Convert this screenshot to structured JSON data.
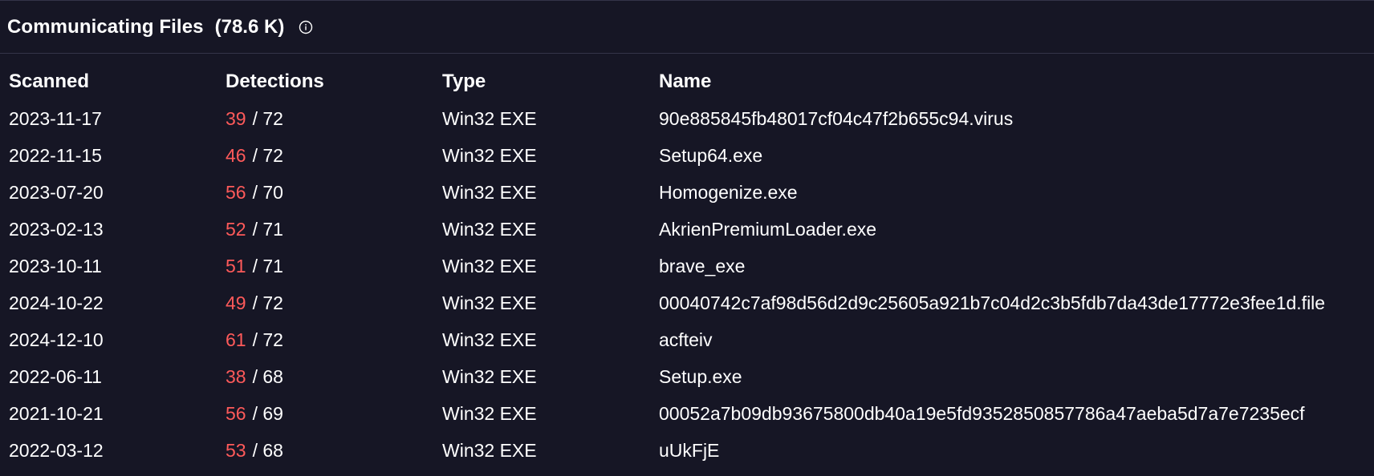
{
  "header": {
    "title": "Communicating Files",
    "count": "(78.6 K)"
  },
  "columns": {
    "scanned": "Scanned",
    "detections": "Detections",
    "type": "Type",
    "name": "Name"
  },
  "rows": [
    {
      "scanned": "2023-11-17",
      "positives": "39",
      "total": "/ 72",
      "type": "Win32 EXE",
      "name": "90e885845fb48017cf04c47f2b655c94.virus"
    },
    {
      "scanned": "2022-11-15",
      "positives": "46",
      "total": "/ 72",
      "type": "Win32 EXE",
      "name": "Setup64.exe"
    },
    {
      "scanned": "2023-07-20",
      "positives": "56",
      "total": "/ 70",
      "type": "Win32 EXE",
      "name": "Homogenize.exe"
    },
    {
      "scanned": "2023-02-13",
      "positives": "52",
      "total": "/ 71",
      "type": "Win32 EXE",
      "name": "AkrienPremiumLoader.exe"
    },
    {
      "scanned": "2023-10-11",
      "positives": "51",
      "total": "/ 71",
      "type": "Win32 EXE",
      "name": "brave_exe"
    },
    {
      "scanned": "2024-10-22",
      "positives": "49",
      "total": "/ 72",
      "type": "Win32 EXE",
      "name": "00040742c7af98d56d2d9c25605a921b7c04d2c3b5fdb7da43de17772e3fee1d.file"
    },
    {
      "scanned": "2024-12-10",
      "positives": "61",
      "total": "/ 72",
      "type": "Win32 EXE",
      "name": "acfteiv"
    },
    {
      "scanned": "2022-06-11",
      "positives": "38",
      "total": "/ 68",
      "type": "Win32 EXE",
      "name": "Setup.exe"
    },
    {
      "scanned": "2021-10-21",
      "positives": "56",
      "total": "/ 69",
      "type": "Win32 EXE",
      "name": "00052a7b09db93675800db40a19e5fd9352850857786a47aeba5d7a7e7235ecf"
    },
    {
      "scanned": "2022-03-12",
      "positives": "53",
      "total": "/ 68",
      "type": "Win32 EXE",
      "name": "uUkFjE"
    }
  ],
  "icons": {
    "info": "info-icon"
  },
  "colors": {
    "background": "#161625",
    "positives": "#ff5a5a",
    "divider": "#343449"
  }
}
